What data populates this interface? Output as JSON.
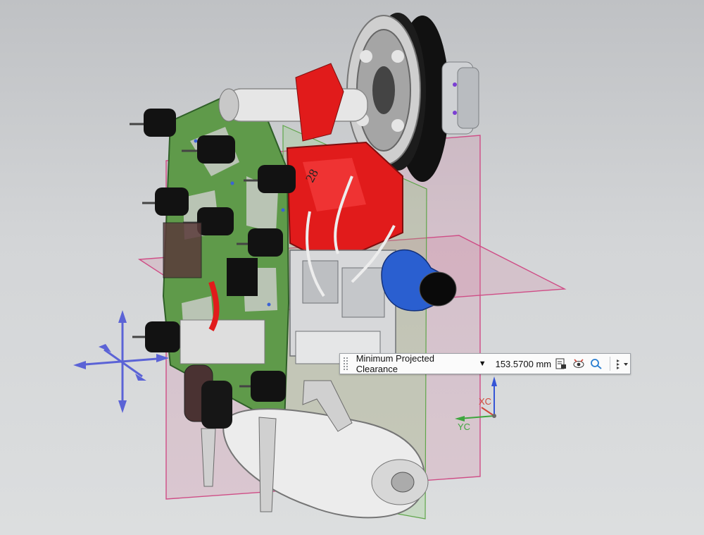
{
  "toolbar": {
    "measure_mode": "Minimum Projected Clearance",
    "measure_value": "153.5700",
    "unit": "mm",
    "icons": [
      "save-results-icon",
      "show-hide-icon",
      "measure-settings-icon",
      "more-options-icon"
    ]
  },
  "triad": {
    "x_label": "XC",
    "y_label": "YC"
  },
  "colors": {
    "background_top": "#bfc1c4",
    "background_bottom": "#dcdedf",
    "plate": "#5f9a4a",
    "engine_block": "#e11b1b",
    "intake": "#2a5fd0",
    "datum_plane": "#d87aa0",
    "manipulator": "#5b63d6"
  }
}
